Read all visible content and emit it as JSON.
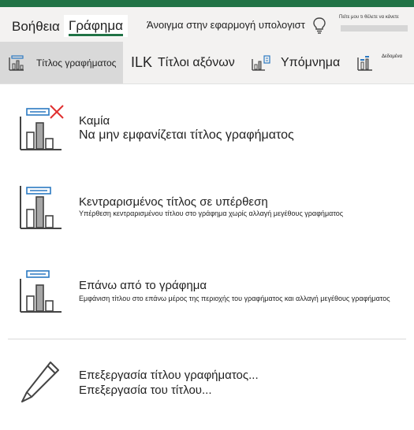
{
  "tabs": {
    "help": "Βοήθεια",
    "chart": "Γράφημα",
    "open_app": "Άνοιγμα στην εφαρμογή υπολογιστ",
    "tell_me": "Πείτε μου τι θέλετε να κάνετε"
  },
  "toolbar": {
    "chart_title": "Τίτλος γραφήματος",
    "axis_titles_prefix": "ILK",
    "axis_titles": "Τίτλοι αξόνων",
    "legend": "Υπόμνημα",
    "data_labels": "Δεδομένα"
  },
  "menu": {
    "none": {
      "title": "Καμία",
      "desc": "Να μην εμφανίζεται τίτλος γραφήματος"
    },
    "centered_overlay": {
      "title": "Κεντραρισμένος τίτλος σε υπέρθεση",
      "desc": "Υπέρθεση κεντραρισμένου τίτλου στο γράφημα χωρίς αλλαγή μεγέθους γραφήματος"
    },
    "above_chart": {
      "title": "Επάνω από το γράφημα",
      "desc": "Εμφάνιση τίτλου στο επάνω μέρος της περιοχής του γραφήματος και αλλαγή μεγέθους γραφήματος"
    },
    "edit_title": {
      "title": "Επεξεργασία τίτλου γραφήματος...",
      "desc": "Επεξεργασία του τίτλου..."
    }
  },
  "colors": {
    "excel_green": "#217346",
    "title_blue": "#2b79c2",
    "remove_red": "#e03030",
    "bar_gray": "#a6a6a6"
  },
  "icons": {
    "bulb": "lightbulb-icon",
    "chart_title": "chart-title-icon",
    "legend": "legend-icon",
    "data_labels": "data-labels-icon",
    "none": "chart-title-none-icon",
    "overlay": "chart-title-overlay-icon",
    "above": "chart-title-above-icon",
    "edit": "pencil-icon"
  }
}
